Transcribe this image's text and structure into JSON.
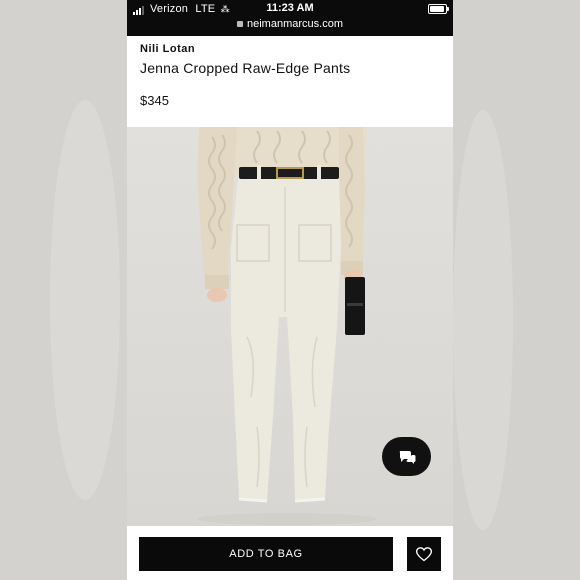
{
  "status_bar": {
    "carrier": "Verizon",
    "network": "LTE",
    "time": "11:23 AM",
    "url": "neimanmarcus.com",
    "battery_level": 0.9,
    "signal_bars": 3
  },
  "product": {
    "brand": "Nili Lotan",
    "title": "Jenna Cropped Raw-Edge Pants",
    "price": "$345"
  },
  "actions": {
    "add_to_bag": "ADD TO BAG"
  },
  "icons": {
    "chat": "chat-bubbles-icon",
    "wishlist": "heart-icon",
    "lock": "lock-icon"
  },
  "colors": {
    "primary": "#0a0a0a",
    "status_bar": "#0b0b0b",
    "pants": "#ece9df",
    "sweater": "#e6dccb"
  }
}
